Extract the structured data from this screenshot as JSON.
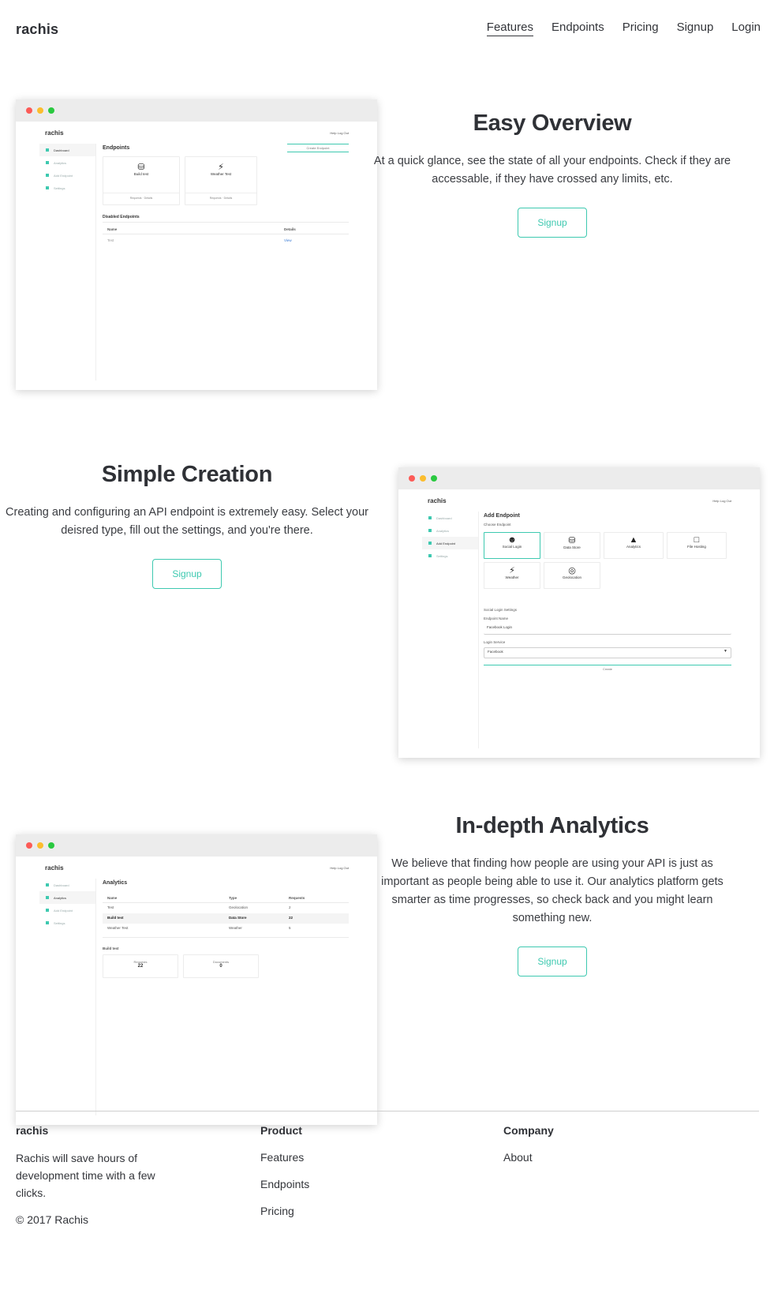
{
  "header": {
    "brand": "rachis",
    "nav": [
      {
        "label": "Features",
        "active": true
      },
      {
        "label": "Endpoints",
        "active": false
      },
      {
        "label": "Pricing",
        "active": false
      },
      {
        "label": "Signup",
        "active": false
      },
      {
        "label": "Login",
        "active": false
      }
    ]
  },
  "sections": [
    {
      "title": "Easy Overview",
      "text": "At a quick glance, see the state of all your endpoints. Check if they are accessable, if they have crossed any limits, etc.",
      "cta": "Signup",
      "mock": {
        "brand": "rachis",
        "top_links": "Help   Log Out",
        "sidebar": [
          "Dashboard",
          "Analytics",
          "Add Endpoint",
          "Settings"
        ],
        "heading": "Endpoints",
        "button": "Create Endpoint",
        "cards": [
          {
            "label": "Build test",
            "icon": "database-icon",
            "meta": "Requests · Details"
          },
          {
            "label": "Weather Test",
            "icon": "bolt-icon",
            "meta": "Requests · Details"
          }
        ],
        "disabled_heading": "Disabled Endpoints",
        "table_headers": [
          "Name",
          "Details"
        ],
        "table_rows": [
          [
            "Test",
            "View"
          ]
        ]
      }
    },
    {
      "title": "Simple Creation",
      "text": "Creating and configuring an API endpoint is extremely easy. Select your deisred type, fill out the settings, and you're there.",
      "cta": "Signup",
      "mock": {
        "brand": "rachis",
        "top_links": "Help   Log Out",
        "sidebar": [
          "Dashboard",
          "Analytics",
          "Add Endpoint",
          "Settings"
        ],
        "heading": "Add Endpoint",
        "sub": "Choose Endpoint",
        "types": [
          {
            "label": "Social Login",
            "icon": "users-icon"
          },
          {
            "label": "Data Store",
            "icon": "database-icon"
          },
          {
            "label": "Analytics",
            "icon": "chart-icon"
          },
          {
            "label": "File Hosting",
            "icon": "file-icon"
          },
          {
            "label": "Weather",
            "icon": "bolt-icon"
          },
          {
            "label": "Geolocation",
            "icon": "target-icon"
          }
        ],
        "settings_heading": "Social Login Settings",
        "name_label": "Endpoint Name",
        "name_value": "Facebook Login",
        "service_label": "Login Service",
        "service_value": "Facebook",
        "submit": "Create"
      }
    },
    {
      "title": "In-depth Analytics",
      "text": "We believe that finding how people are using your API is just as important as people being able to use it. Our analytics platform gets smarter as time progresses, so check back and you might learn something new.",
      "cta": "Signup",
      "mock": {
        "brand": "rachis",
        "top_links": "Help   Log Out",
        "sidebar": [
          "Dashboard",
          "Analytics",
          "Add Endpoint",
          "Settings"
        ],
        "heading": "Analytics",
        "table_headers": [
          "Name",
          "Type",
          "Requests"
        ],
        "table_rows": [
          [
            "Test",
            "Geolocation",
            "2"
          ],
          [
            "Build test",
            "Data Store",
            "22"
          ],
          [
            "Weather Test",
            "Weather",
            "5"
          ]
        ],
        "detail_heading": "Build test",
        "stats": [
          {
            "label": "Requests",
            "value": "22"
          },
          {
            "label": "Documents",
            "value": "0"
          }
        ]
      }
    }
  ],
  "footer": {
    "brand": "rachis",
    "tagline": "Rachis will save hours of development time with a few clicks.",
    "copyright": "© 2017 Rachis",
    "product_heading": "Product",
    "product_links": [
      "Features",
      "Endpoints",
      "Pricing"
    ],
    "company_heading": "Company",
    "company_links": [
      "About"
    ]
  }
}
